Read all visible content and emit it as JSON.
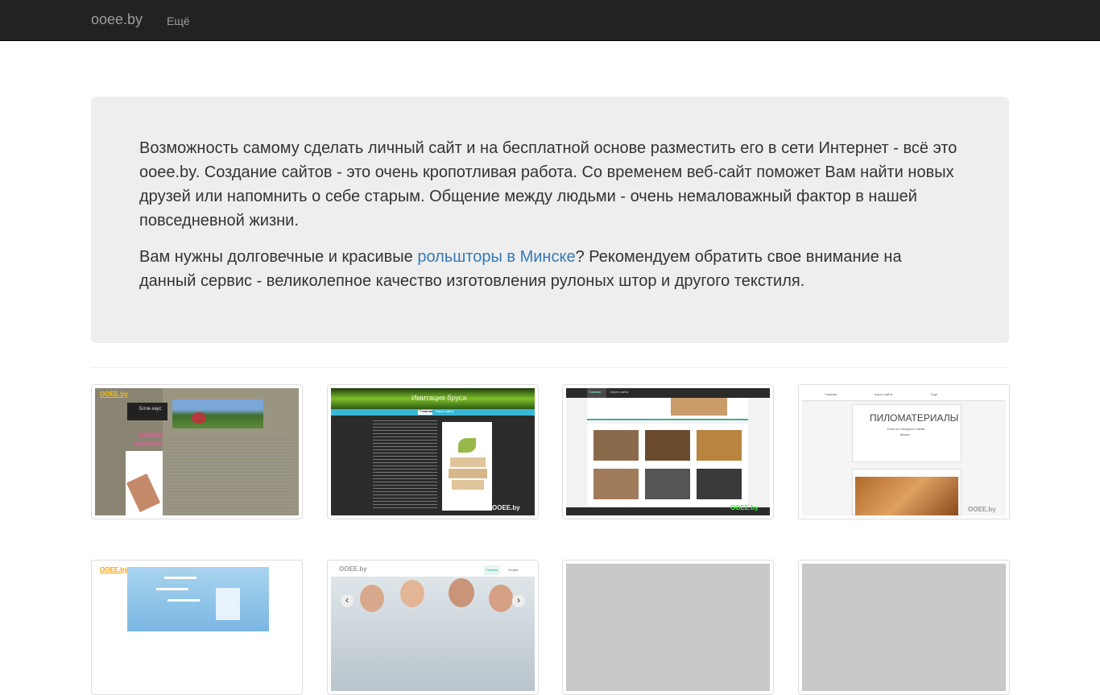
{
  "navbar": {
    "brand": "ooee.by",
    "more": "Ещё"
  },
  "jumbotron": {
    "p1": "Возможность самому сделать личный сайт и на бесплатной основе разместить его в сети Интернет - всё это ooee.by. Создание сайтов - это очень кропотливая работа. Со временем веб-сайт поможет Вам найти новых друзей или напомнить о себе старым. Общение между людьми - очень немаловажный фактор в нашей повседневной жизни.",
    "p2_before": "Вам нужны долговечные и красивые ",
    "p2_link": "рольшторы в Минске",
    "p2_after": "? Рекомендуем обратить свое внимание на данный сервис - великолепное качество изготовления рулоных штор и другого текстиля."
  },
  "thumbs": {
    "t1": {
      "logo": "OOEE.by",
      "sign": "Блок-хаус"
    },
    "t2": {
      "title": "Имитация бруса",
      "nav_home": "Главная",
      "nav_map": "Карта сайта",
      "logo": "OOEE.by"
    },
    "t3": {
      "nav_home": "Главная",
      "nav_map": "Карта сайта",
      "logo": "OOEE.by"
    },
    "t4": {
      "nav1": "Главная",
      "nav2": "Карта сайта",
      "nav3": "Ещё",
      "title": "ПИЛОМАТЕРИАЛЫ",
      "sub1": "Блок из отборных статей",
      "sub2": "Минск",
      "logo": "OOEE.by"
    },
    "t5": {
      "logo": "OOEE.by"
    },
    "t6": {
      "logo": "OOEE.by",
      "nav_home": "Главная",
      "nav_services": "Услуги",
      "prev": "‹",
      "next": "›"
    }
  },
  "colors": {
    "navbar_bg": "#222222",
    "jumbotron_bg": "#eeeeee",
    "link": "#337ab7"
  }
}
